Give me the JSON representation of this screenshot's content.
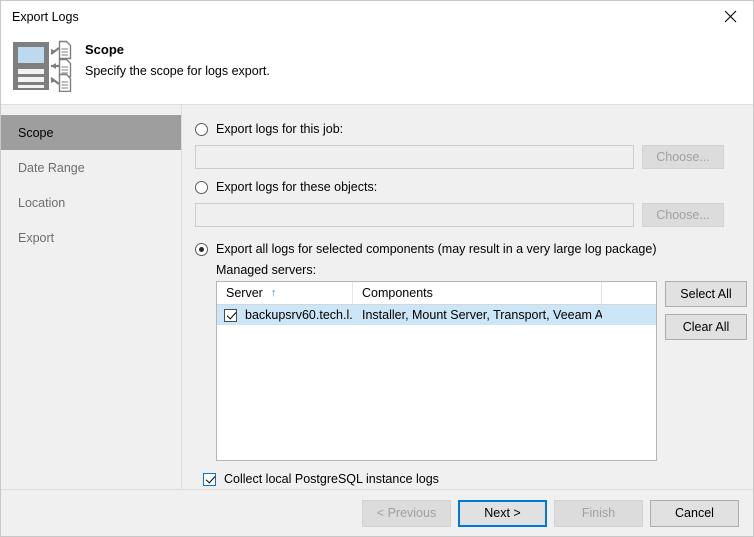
{
  "window": {
    "title": "Export Logs",
    "close_icon": "close-icon"
  },
  "header": {
    "icon": "server-logs-export-icon",
    "title": "Scope",
    "subtitle": "Specify the scope for logs export."
  },
  "sidebar": {
    "items": [
      {
        "label": "Scope",
        "active": true
      },
      {
        "label": "Date Range",
        "active": false
      },
      {
        "label": "Location",
        "active": false
      },
      {
        "label": "Export",
        "active": false
      }
    ]
  },
  "main": {
    "options": [
      {
        "id": "this-job",
        "label": "Export logs for this job:",
        "selected": false,
        "input_value": "",
        "button_label": "Choose...",
        "button_enabled": false
      },
      {
        "id": "these-objects",
        "label": "Export logs for these objects:",
        "selected": false,
        "input_value": "",
        "button_label": "Choose...",
        "button_enabled": false
      },
      {
        "id": "all-components",
        "label": "Export all logs for selected components (may result in a very large log package)",
        "selected": true
      }
    ],
    "grid_label": "Managed servers:",
    "grid": {
      "columns": [
        "Server",
        "Components",
        ""
      ],
      "sort_column": "Server",
      "sort_indicator": "↑",
      "rows": [
        {
          "checked": true,
          "server": "backupsrv60.tech.l...",
          "components": "Installer, Mount Server, Transport, Veeam A..."
        }
      ]
    },
    "grid_buttons": [
      {
        "label": "Select All"
      },
      {
        "label": "Clear All"
      }
    ],
    "collect_postgres": {
      "label": "Collect local PostgreSQL instance logs",
      "checked": true
    }
  },
  "footer": {
    "buttons": [
      {
        "label": "< Previous",
        "enabled": false,
        "focused": false
      },
      {
        "label": "Next >",
        "enabled": true,
        "focused": true
      },
      {
        "label": "Finish",
        "enabled": false,
        "focused": false
      },
      {
        "label": "Cancel",
        "enabled": true,
        "focused": false
      }
    ]
  },
  "colors": {
    "accent": "#0078d7",
    "selection": "#cde6f7",
    "sidebar_active": "#9e9e9e",
    "sort_arrow": "#4a90c4"
  }
}
